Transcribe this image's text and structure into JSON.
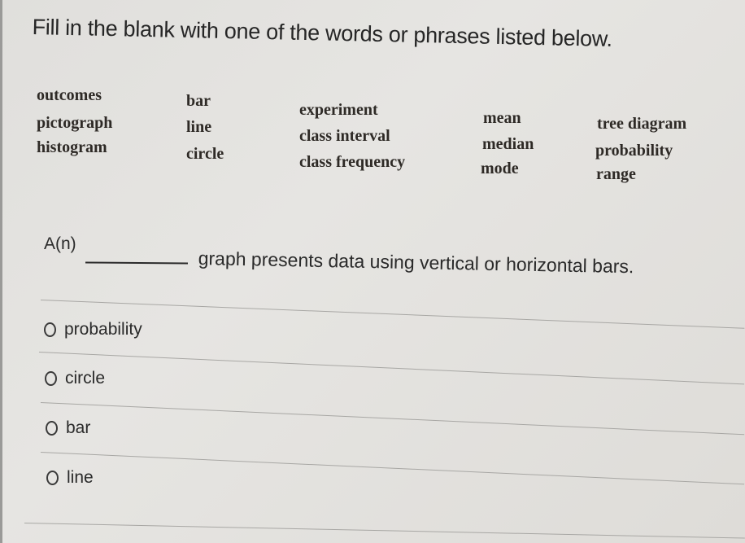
{
  "instruction": "Fill in the blank with one of the words or phrases listed below.",
  "word_bank": {
    "col1": [
      "outcomes",
      "pictograph",
      "histogram"
    ],
    "col2": [
      "bar",
      "line",
      "circle"
    ],
    "col3": [
      "experiment",
      "class interval",
      "class frequency"
    ],
    "col4": [
      "mean",
      "median",
      "mode"
    ],
    "col5": [
      "tree diagram",
      "probability",
      "range"
    ]
  },
  "question": {
    "prefix": "A(n)",
    "text": "graph presents data using vertical or horizontal bars."
  },
  "options": [
    {
      "label": "probability",
      "selected": false
    },
    {
      "label": "circle",
      "selected": false
    },
    {
      "label": "bar",
      "selected": false
    },
    {
      "label": "line",
      "selected": false
    }
  ]
}
